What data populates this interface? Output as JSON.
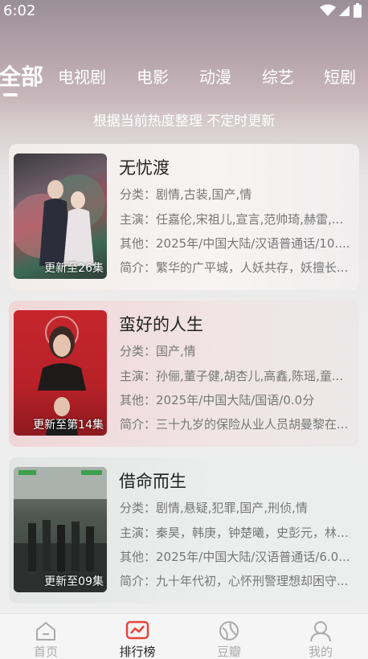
{
  "status": {
    "time": "6:02"
  },
  "tabs": [
    {
      "label": "全部",
      "active": true
    },
    {
      "label": "电视剧",
      "active": false
    },
    {
      "label": "电影",
      "active": false
    },
    {
      "label": "动漫",
      "active": false
    },
    {
      "label": "综艺",
      "active": false
    },
    {
      "label": "短剧",
      "active": false
    }
  ],
  "subtitle": "根据当前热度整理 不定时更新",
  "items": [
    {
      "title": "无忧渡",
      "badge": "更新至26集",
      "category": "分类：剧情,古装,国产,情",
      "cast": "主演：任嘉伦,宋祖儿,宣言,范帅琦,赫雷,...",
      "other": "其他：2025年/中国大陆/汉语普通话/10....",
      "intro": "简介：繁华的广平城，人妖共存，妖擅长..."
    },
    {
      "title": "蛮好的人生",
      "badge": "更新至第14集",
      "category": "分类：国产,情",
      "cast": "主演：孙俪,董子健,胡杏儿,高鑫,陈瑶,童...",
      "other": "其他：2025年/中国大陆/国语/0.0分",
      "intro": "简介：三十九岁的保险从业人员胡曼黎在..."
    },
    {
      "title": "借命而生",
      "badge": "更新至09集",
      "category": "分类：剧情,悬疑,犯罪,国产,刑侦,情",
      "cast": "主演：秦昊，韩庚，钟楚曦，史彭元，林博...",
      "other": "其他：2025年/中国大陆/汉语普通话/6.0...",
      "intro": "简介：九十年代初，心怀刑警理想却困守..."
    }
  ],
  "nav": [
    {
      "label": "首页",
      "icon": "home-icon",
      "active": false
    },
    {
      "label": "排行榜",
      "icon": "chart-icon",
      "active": true
    },
    {
      "label": "豆瓣",
      "icon": "douban-icon",
      "active": false
    },
    {
      "label": "我的",
      "icon": "user-icon",
      "active": false
    }
  ],
  "colors": {
    "accent": "#e8453c",
    "tab_text": "#ffffff",
    "nav_inactive": "#aaaaaa"
  }
}
